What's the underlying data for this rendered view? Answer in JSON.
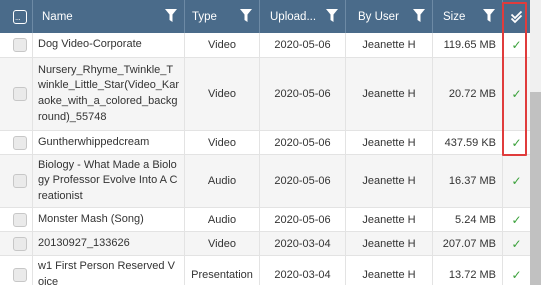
{
  "columns": {
    "name": "Name",
    "type": "Type",
    "uploaded": "Upload...",
    "by_user": "By User",
    "size": "Size"
  },
  "header_checkbox_glyph": "...",
  "rows": [
    {
      "name": "Dog Video-Corporate",
      "type": "Video",
      "date": "2020-05-06",
      "user": "Jeanette H",
      "size": "119.65 MB",
      "status": "✓"
    },
    {
      "name": "Nursery_Rhyme_Twinkle_Twinkle_Little_Star(Video_Karaoke_with_a_colored_background)_55748",
      "type": "Video",
      "date": "2020-05-06",
      "user": "Jeanette H",
      "size": "20.72 MB",
      "status": "✓"
    },
    {
      "name": "Guntherwhippedcream",
      "type": "Video",
      "date": "2020-05-06",
      "user": "Jeanette H",
      "size": "437.59 KB",
      "status": "✓"
    },
    {
      "name": "Biology - What Made a Biology Professor Evolve Into A Creationist",
      "type": "Audio",
      "date": "2020-05-06",
      "user": "Jeanette H",
      "size": "16.37 MB",
      "status": "✓"
    },
    {
      "name": "Monster Mash (Song)",
      "type": "Audio",
      "date": "2020-05-06",
      "user": "Jeanette H",
      "size": "5.24 MB",
      "status": "✓"
    },
    {
      "name": "20130927_133626",
      "type": "Video",
      "date": "2020-03-04",
      "user": "Jeanette H",
      "size": "207.07 MB",
      "status": "✓"
    },
    {
      "name": "w1 First Person Reserved Voice",
      "type": "Presentation",
      "date": "2020-03-04",
      "user": "Jeanette H",
      "size": "13.72 MB",
      "status": "✓"
    }
  ],
  "colors": {
    "header_bg": "#4a6b8a",
    "check_green": "#3aa13a",
    "highlight_red": "#e03c3c"
  }
}
